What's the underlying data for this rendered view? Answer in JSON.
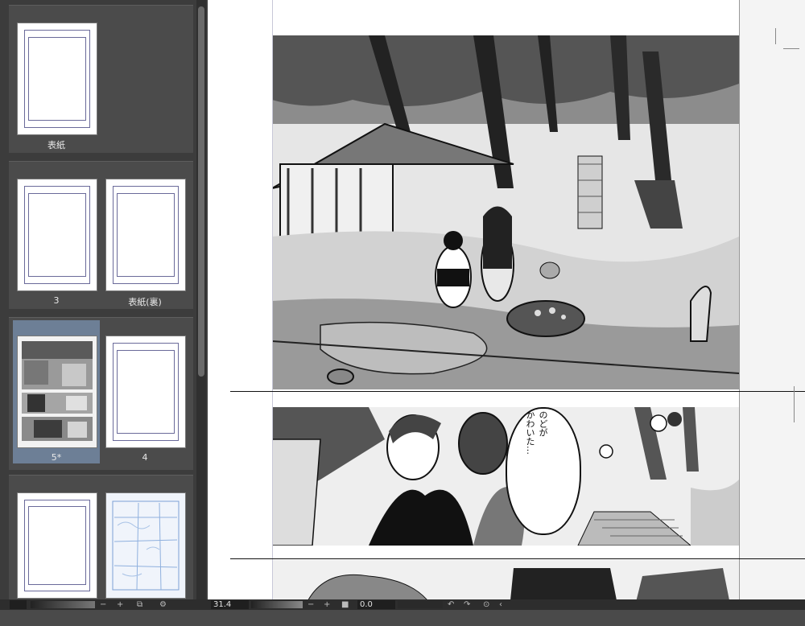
{
  "pages": {
    "cover_label": "表紙",
    "page3_label": "3",
    "back_cover_label": "表紙(裏)",
    "page5_label": "5*",
    "page4_label": "4"
  },
  "bubble": {
    "text_col1": "のどが",
    "text_col2": "かわいた…"
  },
  "statusbar": {
    "zoom_value": "31.4",
    "rotation_value": "0.0",
    "minus_label": "−",
    "plus_label": "+"
  },
  "colors": {
    "selected_page_bg": "#6d7f96",
    "panel_bg": "#3c3c3c",
    "canvas_bg": "#ffffff"
  }
}
